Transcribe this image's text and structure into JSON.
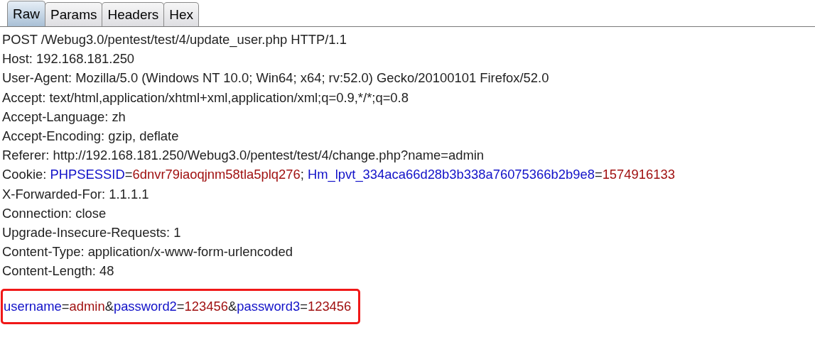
{
  "tabs": [
    {
      "label": "Raw",
      "selected": true
    },
    {
      "label": "Params",
      "selected": false
    },
    {
      "label": "Headers",
      "selected": false
    },
    {
      "label": "Hex",
      "selected": false
    }
  ],
  "request_lines": [
    [
      {
        "kind": "plain",
        "text": "POST /Webug3.0/pentest/test/4/update_user.php HTTP/1.1"
      }
    ],
    [
      {
        "kind": "plain",
        "text": "Host: 192.168.181.250"
      }
    ],
    [
      {
        "kind": "plain",
        "text": "User-Agent: Mozilla/5.0 (Windows NT 10.0; Win64; x64; rv:52.0) Gecko/20100101 Firefox/52.0"
      }
    ],
    [
      {
        "kind": "plain",
        "text": "Accept: text/html,application/xhtml+xml,application/xml;q=0.9,*/*;q=0.8"
      }
    ],
    [
      {
        "kind": "plain",
        "text": "Accept-Language: zh"
      }
    ],
    [
      {
        "kind": "plain",
        "text": "Accept-Encoding: gzip, deflate"
      }
    ],
    [
      {
        "kind": "plain",
        "text": "Referer: http://192.168.181.250/Webug3.0/pentest/test/4/change.php?name=admin"
      }
    ],
    [
      {
        "kind": "plain",
        "text": "Cookie: "
      },
      {
        "kind": "name",
        "text": "PHPSESSID"
      },
      {
        "kind": "plain",
        "text": "="
      },
      {
        "kind": "value",
        "text": "6dnvr79iaoqjnm58tla5plq276"
      },
      {
        "kind": "plain",
        "text": "; "
      },
      {
        "kind": "name",
        "text": "Hm_lpvt_334aca66d28b3b338a76075366b2b9e8"
      },
      {
        "kind": "plain",
        "text": "="
      },
      {
        "kind": "value",
        "text": "1574916133"
      }
    ],
    [
      {
        "kind": "plain",
        "text": "X-Forwarded-For: 1.1.1.1"
      }
    ],
    [
      {
        "kind": "plain",
        "text": "Connection: close"
      }
    ],
    [
      {
        "kind": "plain",
        "text": "Upgrade-Insecure-Requests: 1"
      }
    ],
    [
      {
        "kind": "plain",
        "text": "Content-Type: application/x-www-form-urlencoded"
      }
    ],
    [
      {
        "kind": "plain",
        "text": "Content-Length: 48"
      }
    ]
  ],
  "body": {
    "highlighted": true,
    "segments": [
      {
        "kind": "name",
        "text": "username"
      },
      {
        "kind": "plain",
        "text": "="
      },
      {
        "kind": "value",
        "text": "admin"
      },
      {
        "kind": "plain",
        "text": "&"
      },
      {
        "kind": "name",
        "text": "password2"
      },
      {
        "kind": "plain",
        "text": "="
      },
      {
        "kind": "value",
        "text": "123456"
      },
      {
        "kind": "plain",
        "text": "&"
      },
      {
        "kind": "name",
        "text": "password3"
      },
      {
        "kind": "plain",
        "text": "="
      },
      {
        "kind": "value",
        "text": "123456"
      }
    ]
  }
}
